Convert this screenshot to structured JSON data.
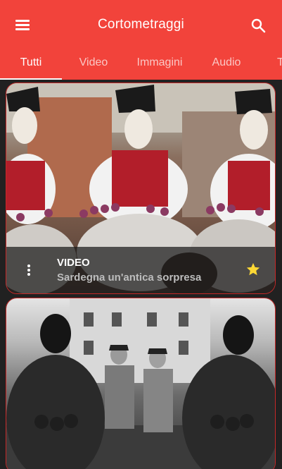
{
  "toolbar": {
    "title": "Cortometraggi",
    "menu_icon": "menu-icon",
    "search_icon": "search-icon"
  },
  "tabs": [
    {
      "label": "Tutti",
      "active": true
    },
    {
      "label": "Video",
      "active": false
    },
    {
      "label": "Immagini",
      "active": false
    },
    {
      "label": "Audio",
      "active": false
    },
    {
      "label": "T",
      "active": false
    }
  ],
  "cards": [
    {
      "type_label": "VIDEO",
      "title": "Sardegna un'antica sorpresa",
      "favorite": true,
      "favorite_icon": "star-icon",
      "more_icon": "more-vert-icon"
    }
  ],
  "colors": {
    "primary": "#f2433b",
    "background": "#212121",
    "star": "#fdd835"
  }
}
